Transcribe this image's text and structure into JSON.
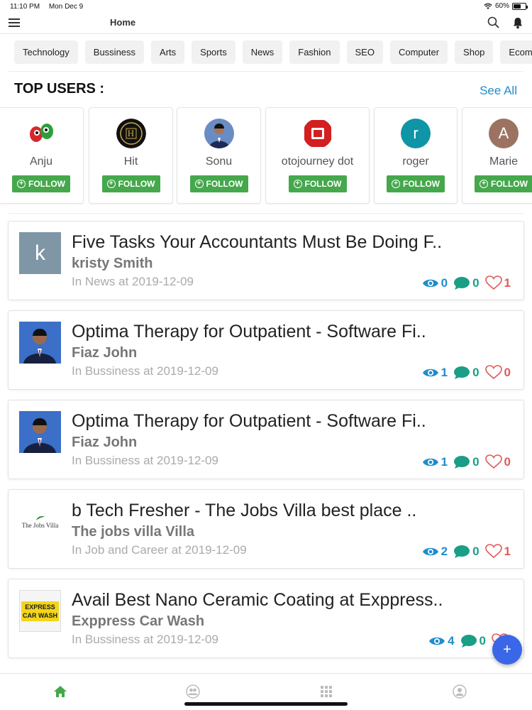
{
  "status_bar": {
    "time": "11:10 PM",
    "date": "Mon Dec 9",
    "battery": "60%",
    "battery_level": 0.6
  },
  "header": {
    "title": "Home",
    "menu_icon": "hamburger-icon",
    "search_icon": "search-icon",
    "bell_icon": "bell-icon"
  },
  "categories": [
    "Technology",
    "Bussiness",
    "Arts",
    "Sports",
    "News",
    "Fashion",
    "SEO",
    "Computer",
    "Shop",
    "Ecommerce"
  ],
  "top_users": {
    "title": "TOP USERS :",
    "see_all": "See All",
    "follow_label": "FOLLOW",
    "users": [
      {
        "name": "Anju",
        "avatar": "cartoon-eyes-avatar"
      },
      {
        "name": "Hit",
        "avatar": "h-monogram-avatar",
        "initial": "H"
      },
      {
        "name": "Sonu",
        "avatar": "photo-avatar"
      },
      {
        "name": "otojourney dot",
        "avatar": "red-square-logo-avatar"
      },
      {
        "name": "roger",
        "avatar": "letter-avatar",
        "initial": "r",
        "color": "#0f95a5"
      },
      {
        "name": "Marie",
        "avatar": "letter-avatar",
        "initial": "A",
        "color": "#9c7363"
      }
    ]
  },
  "posts": [
    {
      "title": "Five Tasks Your Accountants Must Be Doing F..",
      "author": "kristy Smith",
      "meta": "In News at 2019-12-09",
      "views": "0",
      "comments": "0",
      "likes": "1",
      "thumb": "letter-avatar",
      "initial": "k"
    },
    {
      "title": "Optima Therapy for Outpatient - Software Fi..",
      "author": "Fiaz John",
      "meta": "In Bussiness at 2019-12-09",
      "views": "1",
      "comments": "0",
      "likes": "0",
      "thumb": "photo-avatar"
    },
    {
      "title": "Optima Therapy for Outpatient - Software Fi..",
      "author": "Fiaz John",
      "meta": "In Bussiness at 2019-12-09",
      "views": "1",
      "comments": "0",
      "likes": "0",
      "thumb": "photo-avatar"
    },
    {
      "title": "b Tech Fresher - The Jobs Villa best place ..",
      "author": "The jobs villa Villa",
      "meta": "In Job and Career at 2019-12-09",
      "views": "2",
      "comments": "0",
      "likes": "1",
      "thumb": "jobs-villa-logo",
      "logo_text": "The Jobs Villa"
    },
    {
      "title": "Avail Best Nano Ceramic Coating at Exppress..",
      "author": "Exppress Car Wash",
      "meta": "In Bussiness at 2019-12-09",
      "views": "4",
      "comments": "0",
      "likes": "",
      "thumb": "car-wash-logo",
      "logo_text": "EXPRESS CAR WASH"
    }
  ],
  "fab": {
    "label": "+"
  },
  "bottom_nav": [
    "home-icon",
    "users-icon",
    "grid-icon",
    "profile-icon"
  ],
  "colors": {
    "accent": "#1f8dcc",
    "follow": "#45a84c",
    "comment": "#1a9e86",
    "like": "#e05a5a",
    "fab": "#3a66e8",
    "nav_active": "#45a84c"
  }
}
